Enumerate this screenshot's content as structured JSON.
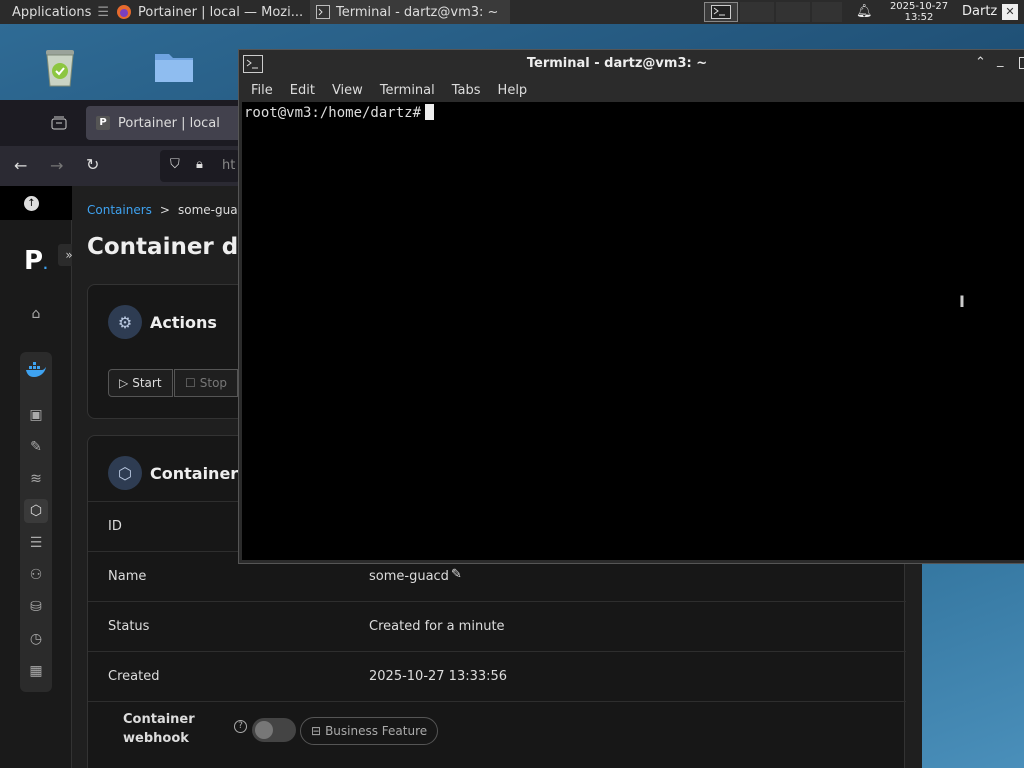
{
  "panel": {
    "applications_label": "Applications",
    "tasks": [
      {
        "label": "Portainer | local — Mozi..."
      },
      {
        "label": "Terminal - dartz@vm3: ~"
      }
    ],
    "clock_date": "2025-10-27",
    "clock_time": "13:52",
    "user": "Dartz"
  },
  "firefox": {
    "tab_title": "Portainer | local",
    "url_fragment": "ht"
  },
  "portainer": {
    "breadcrumb": {
      "parent": "Containers",
      "separator": ">",
      "current": "some-guac"
    },
    "page_title": "Container de",
    "actions_title": "Actions",
    "start_label": "Start",
    "stop_label": "Stop",
    "status_card_title": "Container s",
    "rows": [
      {
        "key": "ID",
        "value": ""
      },
      {
        "key": "Name",
        "value": "some-guacd"
      },
      {
        "key": "Status",
        "value": "Created for a minute"
      },
      {
        "key": "Created",
        "value": "2025-10-27 13:33:56"
      }
    ],
    "webhook_label_line1": "Container",
    "webhook_label_line2": "webhook",
    "business_feature_label": "Business Feature"
  },
  "terminal": {
    "title": "Terminal - dartz@vm3: ~",
    "menu": [
      "File",
      "Edit",
      "View",
      "Terminal",
      "Tabs",
      "Help"
    ],
    "prompt": "root@vm3:/home/dartz#"
  }
}
